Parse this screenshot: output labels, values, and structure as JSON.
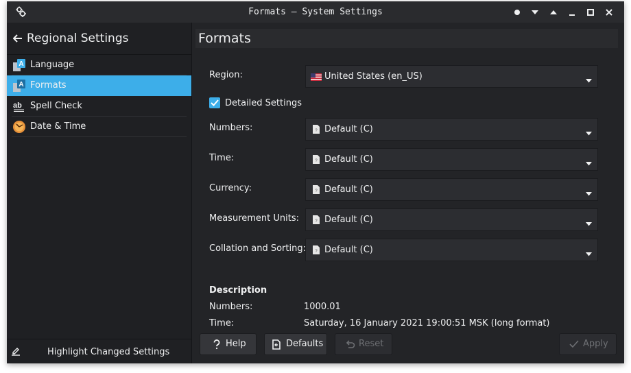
{
  "window": {
    "title": "Formats — System Settings"
  },
  "sidebar": {
    "header_title": "Regional Settings",
    "items": [
      {
        "label": "Language",
        "icon": "language-icon"
      },
      {
        "label": "Formats",
        "icon": "formats-icon",
        "active": true
      },
      {
        "label": "Spell Check",
        "icon": "spellcheck-icon"
      },
      {
        "label": "Date & Time",
        "icon": "clock-icon"
      }
    ],
    "footer_label": "Highlight Changed Settings"
  },
  "main": {
    "page_title": "Formats",
    "region": {
      "label": "Region:",
      "value": "United States (en_US)"
    },
    "detailed": {
      "label": "Detailed Settings",
      "checked": true
    },
    "fields": [
      {
        "label": "Numbers:",
        "value": "Default (C)"
      },
      {
        "label": "Time:",
        "value": "Default (C)"
      },
      {
        "label": "Currency:",
        "value": "Default (C)"
      },
      {
        "label": "Measurement Units:",
        "value": "Default (C)"
      },
      {
        "label": "Collation and Sorting:",
        "value": "Default (C)"
      }
    ],
    "description": {
      "heading": "Description",
      "rows": [
        {
          "key": "Numbers:",
          "value": "1000.01"
        },
        {
          "key": "Time:",
          "value": "Saturday, 16 January 2021 19:00:51 MSK (long format)"
        }
      ]
    }
  },
  "buttons": {
    "help": "Help",
    "defaults": "Defaults",
    "reset": "Reset",
    "apply": "Apply"
  },
  "colors": {
    "accent": "#3daee9",
    "window_bg": "#232427",
    "sidebar_bg": "#1f2023",
    "text": "#eff0f1"
  }
}
